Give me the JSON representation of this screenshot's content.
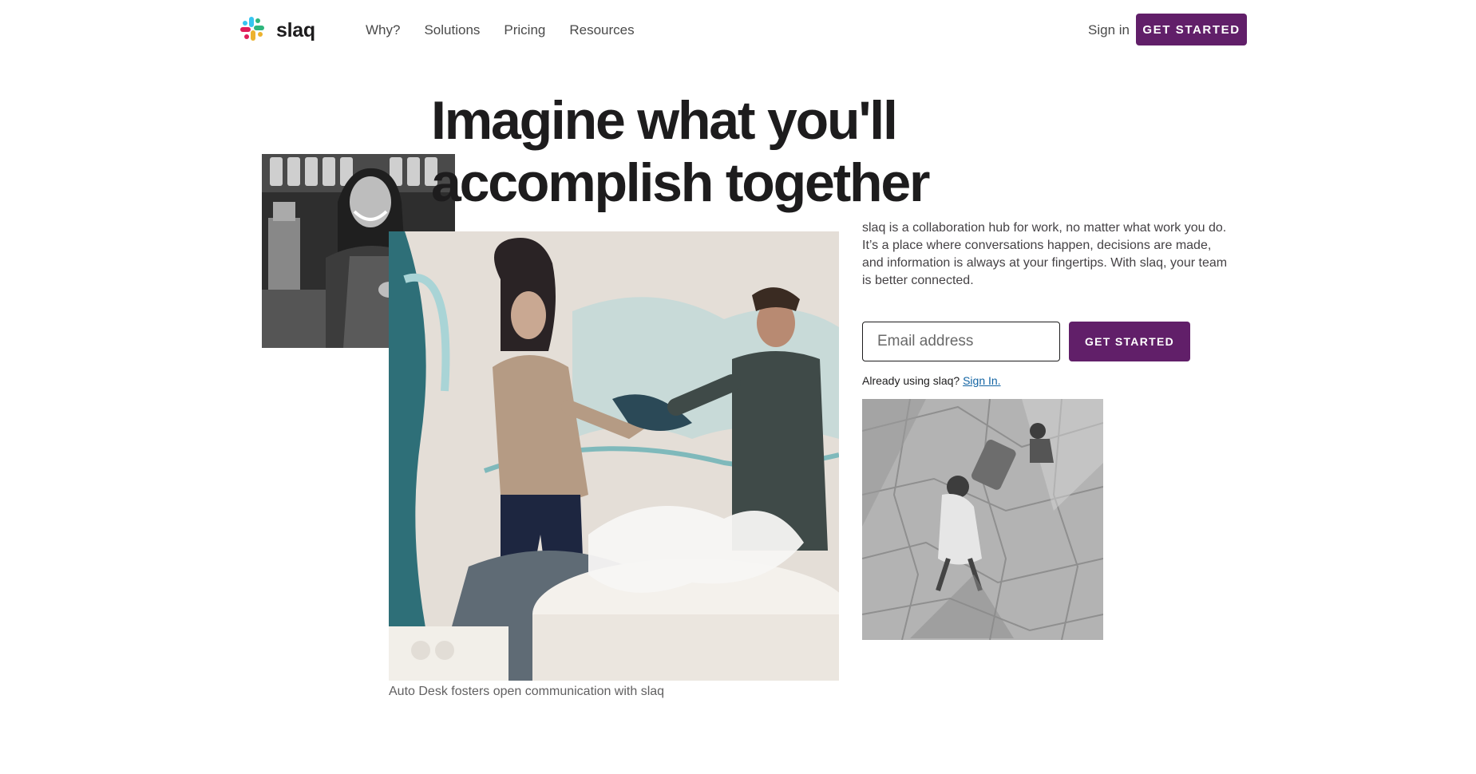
{
  "header": {
    "logo_text": "slaq",
    "nav": [
      "Why?",
      "Solutions",
      "Pricing",
      "Resources"
    ],
    "sign_in": "Sign in",
    "cta": "GET STARTED"
  },
  "hero": {
    "headline_line1": "Imagine what you'll",
    "headline_line2": "accomplish together",
    "description": "slaq is a collaboration hub for work, no matter what work you do. It’s a place where conversations happen, decisions are made, and information is always at your fingertips. With slaq, your team is better connected.",
    "email_placeholder": "Email address",
    "cta": "GET STARTED",
    "already_text": "Already using slaq?",
    "sign_in_link": "Sign In.",
    "caption": "Auto Desk fosters open communication with slaq"
  },
  "colors": {
    "brand": "#611f69",
    "link": "#1264a3",
    "text": "#1d1c1d"
  },
  "icons": {
    "logo": "slack-hash-logo-icon"
  }
}
